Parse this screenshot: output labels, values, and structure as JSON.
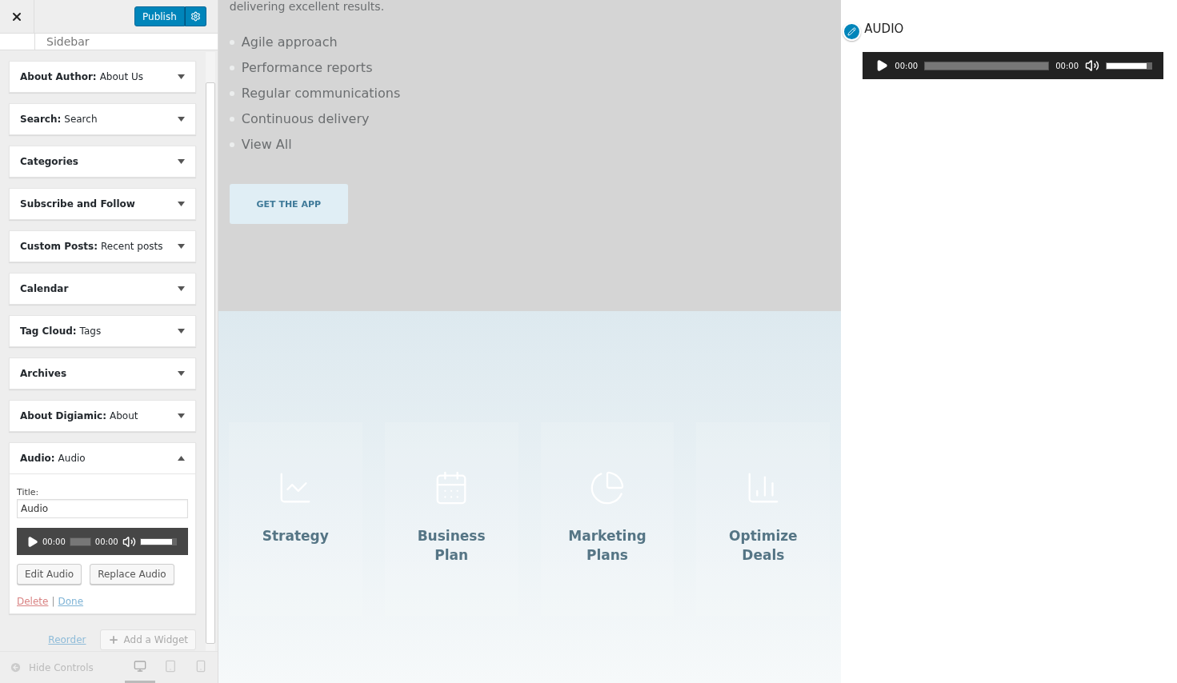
{
  "customizer": {
    "publish_button": "Publish",
    "section_title": "Sidebar",
    "widgets": [
      {
        "name": "About Author:",
        "subtitle": "About Us",
        "expanded": false
      },
      {
        "name": "Search:",
        "subtitle": "Search",
        "expanded": false
      },
      {
        "name": "Categories",
        "expanded": false
      },
      {
        "name": "Subscribe and Follow",
        "expanded": false
      },
      {
        "name": "Custom Posts:",
        "subtitle": "Recent posts",
        "expanded": false
      },
      {
        "name": "Calendar",
        "expanded": false
      },
      {
        "name": "Tag Cloud:",
        "subtitle": "Tags",
        "expanded": false
      },
      {
        "name": "Archives",
        "expanded": false
      },
      {
        "name": "About Digiamic:",
        "subtitle": "About",
        "expanded": false
      },
      {
        "name": "Audio:",
        "subtitle": "Audio",
        "expanded": true,
        "title_label": "Title:",
        "title_value": "Audio",
        "player": {
          "current": "00:00",
          "duration": "00:00",
          "volume": {
            "level": 0.9
          }
        },
        "buttons": [
          "Edit Audio",
          "Replace Audio"
        ],
        "delete_link": "Delete",
        "separator": "|",
        "done_link": "Done"
      }
    ],
    "reorder_link": "Reorder",
    "add_widget_button": "Add a Widget",
    "hide_controls": "Hide Controls",
    "devices": [
      {
        "kind": "desktop",
        "selected": true
      },
      {
        "kind": "tablet",
        "selected": false
      },
      {
        "kind": "mobile",
        "selected": false
      }
    ]
  },
  "preview": {
    "intro_text": "delivering excellent results.",
    "list": [
      "Agile approach",
      "Performance reports",
      "Regular communications",
      "Continuous delivery",
      "View All"
    ],
    "cta_button": "GET THE APP",
    "cards": [
      {
        "kind": "line",
        "title": "Strategy"
      },
      {
        "kind": "calendar",
        "title": "Business Plan"
      },
      {
        "kind": "pie",
        "title": "Marketing Plans"
      },
      {
        "kind": "bars",
        "title": "Optimize Deals"
      }
    ]
  },
  "audio_widget": {
    "title": "AUDIO",
    "player": {
      "current": "00:00",
      "duration": "00:00",
      "volume": {
        "level": 0.9
      }
    }
  }
}
